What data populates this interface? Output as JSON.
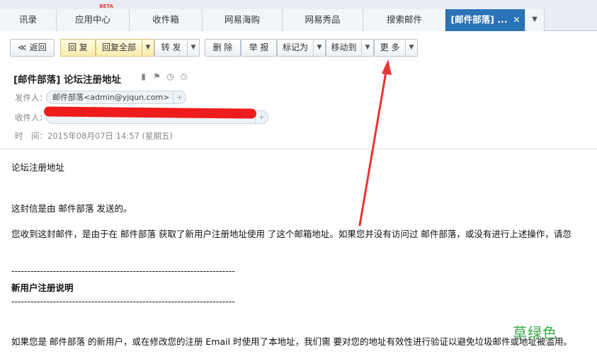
{
  "tabs": [
    {
      "label": "讯录"
    },
    {
      "label": "应用中心",
      "badge": "BETA"
    },
    {
      "label": "收件箱"
    },
    {
      "label": "网易海购"
    },
    {
      "label": "网易秀品"
    },
    {
      "label": "搜索邮件"
    },
    {
      "label": "[邮件部落] ...",
      "close": "✕"
    }
  ],
  "tab_more_icon": "chevron-down-icon",
  "toolbar": {
    "back": "≪ 返回",
    "reply": "回 复",
    "reply_all": "回复全部",
    "forward": "转 发",
    "delete": "删 除",
    "report": "举 报",
    "mark_as": "标记为",
    "move_to": "移动到",
    "more": "更 多"
  },
  "header": {
    "subject": "[邮件部落] 论坛注册地址",
    "from_label": "发件人：",
    "from_value": "邮件部落<admin@yjqun.com>",
    "to_label": "收件人：",
    "time_label": "时　间：",
    "time_value": "2015年08月07日 14:57 (星期五)"
  },
  "body": {
    "line1": "论坛注册地址",
    "line2": "这封信是由 邮件部落 发送的。",
    "line3": "您收到这封邮件，是由于在 邮件部落 获取了新用户注册地址使用 了这个邮箱地址。如果您并没有访问过 邮件部落，或没有进行上述操作，请忽",
    "separator": "----------------------------------------------------------------------",
    "section_title": "新用户注册说明",
    "line4": "如果您是 邮件部落 的新用户，或在修改您的注册 Email 时使用了本地址，我们需 要对您的地址有效性进行验证以避免垃圾邮件或地址被滥用。"
  },
  "watermark": "草绿色",
  "colors": {
    "active_tab": "#2b73b7",
    "annotation_arrow": "#e83434",
    "redaction": "#ee1c1c",
    "watermark": "#3aa84a"
  }
}
